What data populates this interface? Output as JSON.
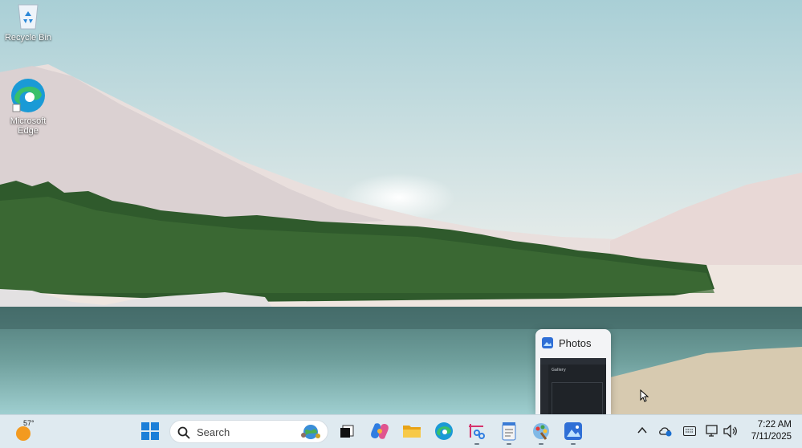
{
  "desktop": {
    "icons": [
      {
        "label": "Recycle Bin",
        "icon": "recycle-bin-icon"
      },
      {
        "label": "Microsoft Edge",
        "icon": "edge-icon"
      }
    ]
  },
  "preview": {
    "title": "Photos",
    "thumb_heading": "Gallery"
  },
  "taskbar": {
    "weather_temp": "57°",
    "search_placeholder": "Search",
    "apps": [
      "start-icon",
      "task-view-icon",
      "copilot-icon",
      "file-explorer-icon",
      "edge-icon",
      "snipping-tool-icon",
      "notepad-icon",
      "paint-icon",
      "photos-icon"
    ]
  },
  "tray": {
    "time": "7:22 AM",
    "date": "7/11/2025",
    "icons": [
      "chevron-up-icon",
      "onedrive-icon",
      "keyboard-icon",
      "network-icon",
      "volume-icon"
    ]
  },
  "colors": {
    "taskbar": "#dfeaf0",
    "accent": "#0078d4"
  }
}
